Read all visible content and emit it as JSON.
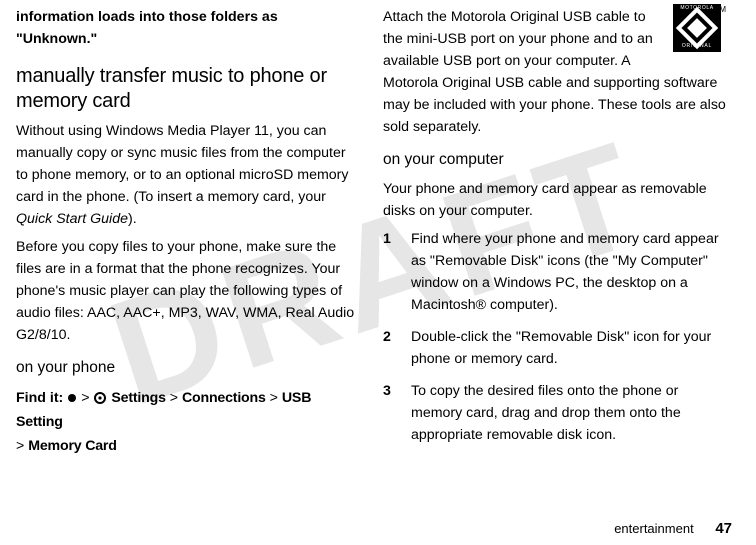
{
  "watermark": "DRAFT",
  "left": {
    "intro_bold": "information loads into those folders as \"Unknown.\"",
    "h2": "manually transfer music to phone or memory card",
    "p1a": "Without using Windows Media Player 11, you can manually copy or sync music files from the computer to phone memory, or to an optional microSD memory card in the phone. (To insert a memory card, your ",
    "p1b_italic": "Quick Start Guide",
    "p1c": ").",
    "p2": "Before you copy files to your phone, make sure the files are in a format that the phone recognizes. Your phone's music player can play the following types of audio files: AAC, AAC+, MP3, WAV, WMA, Real Audio G2/8/10.",
    "h3": "on your phone",
    "findit_label": "Find it:",
    "menu_settings": "Settings",
    "menu_connections": "Connections",
    "menu_usb": "USB Setting",
    "menu_memory": "Memory Card"
  },
  "right": {
    "p1": "Attach the Motorola Original USB cable to the mini-USB port on your phone and to an available USB port on your computer. A Motorola Original USB cable and supporting software may be included with your phone. These tools are also sold separately.",
    "h3": "on your computer",
    "p2": "Your phone and memory card appear as removable disks on your computer.",
    "steps": [
      "Find where your phone and memory card appear as \"Removable Disk\" icons (the \"My Computer\" window on a Windows PC, the desktop on a Macintosh® computer).",
      "Double-click the \"Removable Disk\" icon for your phone or memory card.",
      "To copy the desired files onto the phone or memory card, drag and drop them onto the appropriate removable disk icon."
    ],
    "logo_top": "MOTOROLA",
    "logo_bot": "ORIGINAL",
    "tm": "TM"
  },
  "footer": {
    "section": "entertainment",
    "page": "47"
  }
}
